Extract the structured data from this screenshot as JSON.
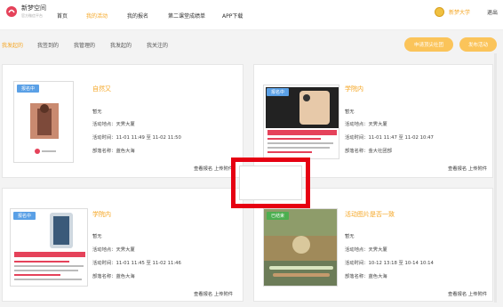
{
  "header": {
    "brand": "新梦空间",
    "brand_sub": "官方微信平台",
    "nav": [
      "首页",
      "我的活动",
      "我的报名",
      "第二课堂成绩单",
      "APP下载"
    ],
    "user_name": "新梦大学",
    "logout": "退出"
  },
  "tabs": [
    "我发起的",
    "我签到的",
    "我管理的",
    "我发起的",
    "我关注的"
  ],
  "buttons": {
    "apply_top": "申请顶尖社团",
    "publish": "发布活动"
  },
  "cards": [
    {
      "title": "自然又",
      "badge": "报名中",
      "desc": "暂无",
      "location_label": "活动地点：",
      "location": "天霁大厦",
      "time_label": "活动时间：",
      "time": "11-01 11:49 至 11-02 11:50",
      "dept_label": "部落名称：",
      "dept": "蓝色大海",
      "links": "查看报名 上传附件"
    },
    {
      "title": "学院内",
      "badge": "报名中",
      "desc": "暂无",
      "location_label": "活动地点：",
      "location": "天霁大厦",
      "time_label": "活动时间：",
      "time": "11-01 11:47 至 11-02 10:47",
      "dept_label": "部落名称：",
      "dept": "金大社团部",
      "links": "查看报名 上传附件"
    },
    {
      "title": "学院内",
      "badge": "报名中",
      "desc": "暂无",
      "location_label": "活动地点：",
      "location": "天霁大厦",
      "time_label": "活动时间：",
      "time": "11-01 11:45 至 11-02 11:46",
      "dept_label": "部落名称：",
      "dept": "蓝色大海",
      "links": "查看报名 上传附件"
    },
    {
      "title": "活动图片是否一致",
      "badge": "已结束",
      "desc": "暂无",
      "location_label": "活动地点：",
      "location": "天霁大厦",
      "time_label": "活动时间：",
      "time": "10-12 13:18 至 10-14 10:14",
      "dept_label": "部落名称：",
      "dept": "蓝色大海",
      "links": "查看报名 上传附件"
    }
  ],
  "colors": {
    "accent": "#f5a623",
    "badge_blue": "#5aa0e6",
    "highlight": "#e60012"
  }
}
